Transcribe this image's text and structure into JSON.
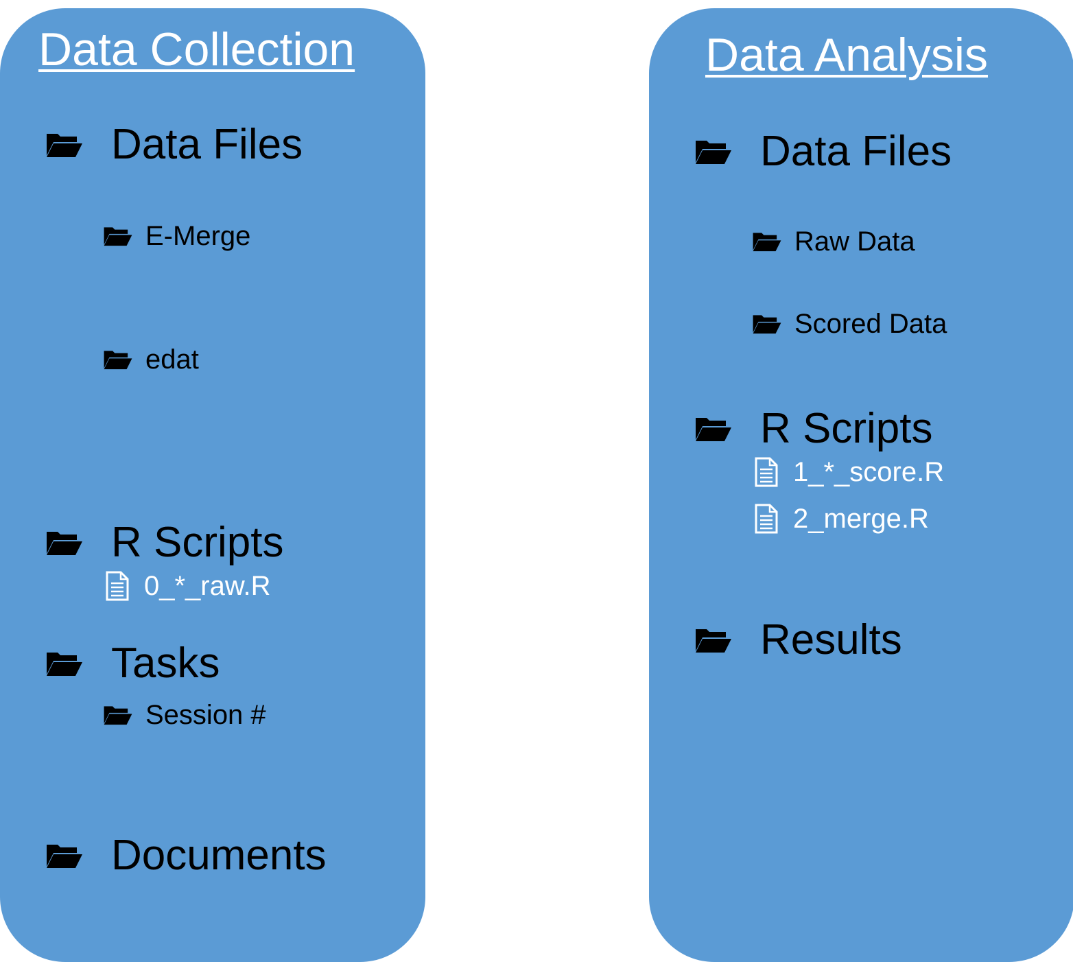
{
  "panels": {
    "collection": {
      "title": "Data Collection",
      "data_files": {
        "label": "Data Files",
        "icon": "folder-open-icon"
      },
      "emerge": {
        "label": "E-Merge",
        "icon": "folder-open-icon"
      },
      "edat": {
        "label": "edat",
        "icon": "folder-open-icon"
      },
      "r_scripts": {
        "label": "R Scripts",
        "icon": "folder-open-icon"
      },
      "raw_script": {
        "label": "0_*_raw.R",
        "icon": "file-text-icon"
      },
      "tasks": {
        "label": "Tasks",
        "icon": "folder-open-icon"
      },
      "session": {
        "label": "Session #",
        "icon": "folder-open-icon"
      },
      "documents": {
        "label": "Documents",
        "icon": "folder-open-icon"
      }
    },
    "analysis": {
      "title": "Data Analysis",
      "data_files": {
        "label": "Data Files",
        "icon": "folder-open-icon"
      },
      "raw_data": {
        "label": "Raw Data",
        "icon": "folder-open-icon"
      },
      "scored_data": {
        "label": "Scored Data",
        "icon": "folder-open-icon"
      },
      "r_scripts": {
        "label": "R Scripts",
        "icon": "folder-open-icon"
      },
      "score_script": {
        "label": "1_*_score.R",
        "icon": "file-text-icon"
      },
      "merge_script": {
        "label": "2_merge.R",
        "icon": "file-text-icon"
      },
      "results": {
        "label": "Results",
        "icon": "folder-open-icon"
      }
    }
  },
  "colors": {
    "panel": "#5b9bd5",
    "title": "#ffffff",
    "folder_text": "#000000",
    "file_text": "#ffffff",
    "folder_icon": "#000000",
    "file_icon": "#ffffff"
  }
}
